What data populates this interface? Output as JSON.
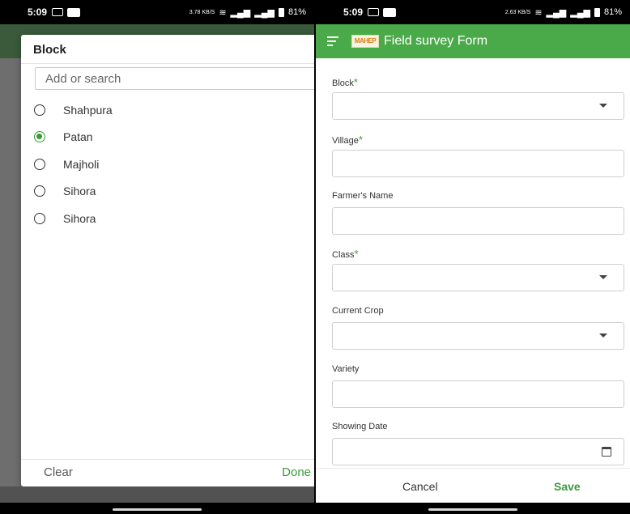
{
  "left_screen": {
    "status": {
      "time": "5:09",
      "network_speed": "3.78 KB/S",
      "battery": "81%"
    },
    "dialog": {
      "title": "Block",
      "search_placeholder": "Add or search",
      "options": [
        {
          "label": "Shahpura",
          "selected": false
        },
        {
          "label": "Patan",
          "selected": true
        },
        {
          "label": "Majholi",
          "selected": false
        },
        {
          "label": "Sihora",
          "selected": false
        },
        {
          "label": "Sihora",
          "selected": false
        }
      ],
      "clear_label": "Clear",
      "done_label": "Done"
    }
  },
  "right_screen": {
    "status": {
      "time": "5:09",
      "network_speed": "2.63 KB/S",
      "battery": "81%"
    },
    "appbar": {
      "logo_text": "MAHEP",
      "title": "Field survey Form"
    },
    "form": {
      "fields": [
        {
          "label": "Block",
          "required": true,
          "type": "dropdown",
          "value": ""
        },
        {
          "label": "Village",
          "required": true,
          "type": "text",
          "value": ""
        },
        {
          "label": "Farmer's Name",
          "required": false,
          "type": "text",
          "value": ""
        },
        {
          "label": "Class",
          "required": true,
          "type": "dropdown",
          "value": ""
        },
        {
          "label": "Current Crop",
          "required": false,
          "type": "dropdown",
          "value": ""
        },
        {
          "label": "Variety",
          "required": false,
          "type": "text",
          "value": ""
        },
        {
          "label": "Showing Date",
          "required": false,
          "type": "date",
          "value": ""
        }
      ],
      "required_marker": "*"
    },
    "footer": {
      "cancel_label": "Cancel",
      "save_label": "Save"
    }
  },
  "colors": {
    "accent_green": "#4aaa49",
    "radio_green": "#3a9a3c"
  }
}
